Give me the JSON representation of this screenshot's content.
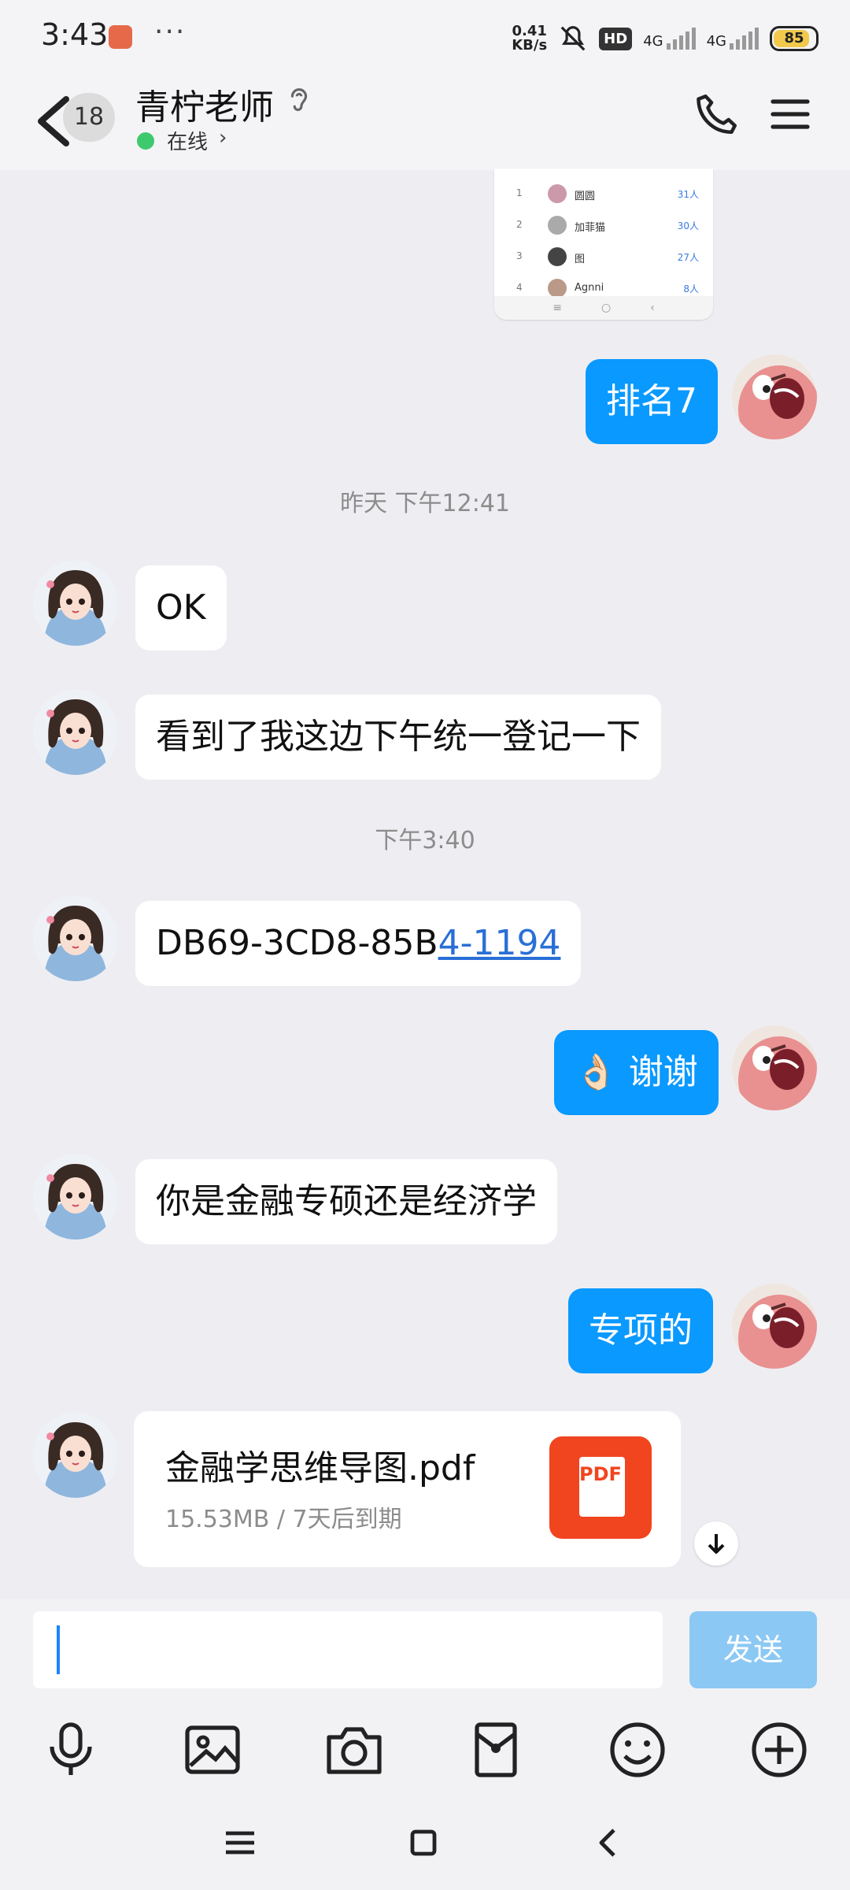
{
  "status_bar": {
    "time": "3:43",
    "dots": "···",
    "speed_value": "0.41",
    "speed_unit": "KB/s",
    "hd_label": "HD",
    "net1": "4G",
    "net2": "4G",
    "battery": "85"
  },
  "header": {
    "unread_count": "18",
    "contact_name": "青柠老师",
    "presence": "在线"
  },
  "shared_image": {
    "rows": [
      {
        "rank": "1",
        "name": "圆圆",
        "count": "31人"
      },
      {
        "rank": "2",
        "name": "加菲猫",
        "count": "30人"
      },
      {
        "rank": "3",
        "name": "图",
        "count": "27人"
      },
      {
        "rank": "4",
        "name": "Agnni",
        "count": "8人"
      }
    ]
  },
  "messages": [
    {
      "side": "out",
      "text": "排名7"
    },
    {
      "type": "time",
      "text": "昨天 下午12:41"
    },
    {
      "side": "in",
      "text": "OK"
    },
    {
      "side": "in",
      "text": "看到了我这边下午统一登记一下"
    },
    {
      "type": "time",
      "text": "下午3:40"
    },
    {
      "side": "in",
      "text_plain": "DB69-3CD8-85B",
      "text_link": "4-1194"
    },
    {
      "side": "out",
      "text": "👌🏻 谢谢"
    },
    {
      "side": "in",
      "text": "你是金融专硕还是经济学"
    },
    {
      "side": "out",
      "text": "专项的"
    }
  ],
  "file": {
    "name": "金融学思维导图.pdf",
    "meta": "15.53MB / 7天后到期",
    "badge": "PDF"
  },
  "composer": {
    "send_label": "发送",
    "tools": [
      "microphone-icon",
      "image-icon",
      "camera-icon",
      "red-packet-icon",
      "emoji-icon",
      "plus-icon"
    ]
  },
  "colors": {
    "outgoing_bubble": "#0a99ff",
    "incoming_bubble": "#ffffff",
    "background": "#eeeef2",
    "link": "#2a6fd6",
    "pdf": "#f1451f",
    "send_disabled": "#8cc8f4",
    "online": "#3ec96e"
  }
}
